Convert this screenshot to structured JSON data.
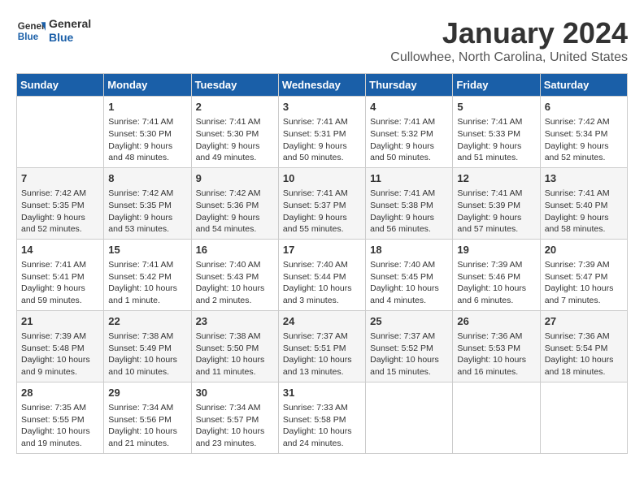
{
  "header": {
    "logo_line1": "General",
    "logo_line2": "Blue",
    "month": "January 2024",
    "location": "Cullowhee, North Carolina, United States"
  },
  "days_of_week": [
    "Sunday",
    "Monday",
    "Tuesday",
    "Wednesday",
    "Thursday",
    "Friday",
    "Saturday"
  ],
  "weeks": [
    [
      {
        "day": "",
        "info": ""
      },
      {
        "day": "1",
        "info": "Sunrise: 7:41 AM\nSunset: 5:30 PM\nDaylight: 9 hours\nand 48 minutes."
      },
      {
        "day": "2",
        "info": "Sunrise: 7:41 AM\nSunset: 5:30 PM\nDaylight: 9 hours\nand 49 minutes."
      },
      {
        "day": "3",
        "info": "Sunrise: 7:41 AM\nSunset: 5:31 PM\nDaylight: 9 hours\nand 50 minutes."
      },
      {
        "day": "4",
        "info": "Sunrise: 7:41 AM\nSunset: 5:32 PM\nDaylight: 9 hours\nand 50 minutes."
      },
      {
        "day": "5",
        "info": "Sunrise: 7:41 AM\nSunset: 5:33 PM\nDaylight: 9 hours\nand 51 minutes."
      },
      {
        "day": "6",
        "info": "Sunrise: 7:42 AM\nSunset: 5:34 PM\nDaylight: 9 hours\nand 52 minutes."
      }
    ],
    [
      {
        "day": "7",
        "info": "Sunrise: 7:42 AM\nSunset: 5:35 PM\nDaylight: 9 hours\nand 52 minutes."
      },
      {
        "day": "8",
        "info": "Sunrise: 7:42 AM\nSunset: 5:35 PM\nDaylight: 9 hours\nand 53 minutes."
      },
      {
        "day": "9",
        "info": "Sunrise: 7:42 AM\nSunset: 5:36 PM\nDaylight: 9 hours\nand 54 minutes."
      },
      {
        "day": "10",
        "info": "Sunrise: 7:41 AM\nSunset: 5:37 PM\nDaylight: 9 hours\nand 55 minutes."
      },
      {
        "day": "11",
        "info": "Sunrise: 7:41 AM\nSunset: 5:38 PM\nDaylight: 9 hours\nand 56 minutes."
      },
      {
        "day": "12",
        "info": "Sunrise: 7:41 AM\nSunset: 5:39 PM\nDaylight: 9 hours\nand 57 minutes."
      },
      {
        "day": "13",
        "info": "Sunrise: 7:41 AM\nSunset: 5:40 PM\nDaylight: 9 hours\nand 58 minutes."
      }
    ],
    [
      {
        "day": "14",
        "info": "Sunrise: 7:41 AM\nSunset: 5:41 PM\nDaylight: 9 hours\nand 59 minutes."
      },
      {
        "day": "15",
        "info": "Sunrise: 7:41 AM\nSunset: 5:42 PM\nDaylight: 10 hours\nand 1 minute."
      },
      {
        "day": "16",
        "info": "Sunrise: 7:40 AM\nSunset: 5:43 PM\nDaylight: 10 hours\nand 2 minutes."
      },
      {
        "day": "17",
        "info": "Sunrise: 7:40 AM\nSunset: 5:44 PM\nDaylight: 10 hours\nand 3 minutes."
      },
      {
        "day": "18",
        "info": "Sunrise: 7:40 AM\nSunset: 5:45 PM\nDaylight: 10 hours\nand 4 minutes."
      },
      {
        "day": "19",
        "info": "Sunrise: 7:39 AM\nSunset: 5:46 PM\nDaylight: 10 hours\nand 6 minutes."
      },
      {
        "day": "20",
        "info": "Sunrise: 7:39 AM\nSunset: 5:47 PM\nDaylight: 10 hours\nand 7 minutes."
      }
    ],
    [
      {
        "day": "21",
        "info": "Sunrise: 7:39 AM\nSunset: 5:48 PM\nDaylight: 10 hours\nand 9 minutes."
      },
      {
        "day": "22",
        "info": "Sunrise: 7:38 AM\nSunset: 5:49 PM\nDaylight: 10 hours\nand 10 minutes."
      },
      {
        "day": "23",
        "info": "Sunrise: 7:38 AM\nSunset: 5:50 PM\nDaylight: 10 hours\nand 11 minutes."
      },
      {
        "day": "24",
        "info": "Sunrise: 7:37 AM\nSunset: 5:51 PM\nDaylight: 10 hours\nand 13 minutes."
      },
      {
        "day": "25",
        "info": "Sunrise: 7:37 AM\nSunset: 5:52 PM\nDaylight: 10 hours\nand 15 minutes."
      },
      {
        "day": "26",
        "info": "Sunrise: 7:36 AM\nSunset: 5:53 PM\nDaylight: 10 hours\nand 16 minutes."
      },
      {
        "day": "27",
        "info": "Sunrise: 7:36 AM\nSunset: 5:54 PM\nDaylight: 10 hours\nand 18 minutes."
      }
    ],
    [
      {
        "day": "28",
        "info": "Sunrise: 7:35 AM\nSunset: 5:55 PM\nDaylight: 10 hours\nand 19 minutes."
      },
      {
        "day": "29",
        "info": "Sunrise: 7:34 AM\nSunset: 5:56 PM\nDaylight: 10 hours\nand 21 minutes."
      },
      {
        "day": "30",
        "info": "Sunrise: 7:34 AM\nSunset: 5:57 PM\nDaylight: 10 hours\nand 23 minutes."
      },
      {
        "day": "31",
        "info": "Sunrise: 7:33 AM\nSunset: 5:58 PM\nDaylight: 10 hours\nand 24 minutes."
      },
      {
        "day": "",
        "info": ""
      },
      {
        "day": "",
        "info": ""
      },
      {
        "day": "",
        "info": ""
      }
    ]
  ]
}
